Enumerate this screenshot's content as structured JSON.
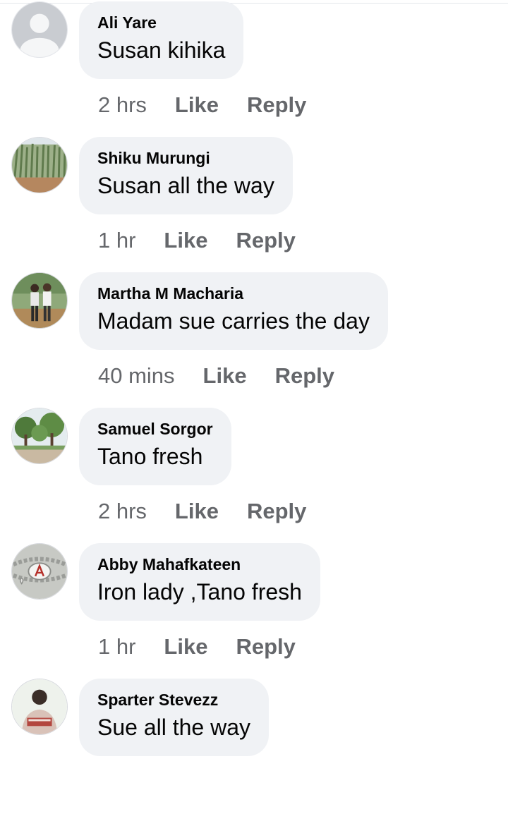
{
  "comments": [
    {
      "author": "Ali Yare",
      "text": "Susan kihika",
      "time": "2 hrs",
      "like": "Like",
      "reply": "Reply",
      "avatar_icon": "default-profile-icon"
    },
    {
      "author": "Shiku Murungi",
      "text": "Susan all the way",
      "time": "1 hr",
      "like": "Like",
      "reply": "Reply",
      "avatar_icon": "profile-photo-crops"
    },
    {
      "author": "Martha M Macharia",
      "text": "Madam sue carries the day",
      "time": "40 mins",
      "like": "Like",
      "reply": "Reply",
      "avatar_icon": "profile-photo-two-people"
    },
    {
      "author": "Samuel Sorgor",
      "text": "Tano fresh",
      "time": "2 hrs",
      "like": "Like",
      "reply": "Reply",
      "avatar_icon": "profile-photo-garden"
    },
    {
      "author": "Abby Mahafkateen",
      "text": "Iron lady ,Tano fresh",
      "time": "1 hr",
      "like": "Like",
      "reply": "Reply",
      "avatar_icon": "profile-photo-bracelet"
    },
    {
      "author": "Sparter Stevezz",
      "text": "Sue all the way",
      "time": "",
      "like": "",
      "reply": "",
      "avatar_icon": "profile-photo-person"
    }
  ],
  "colors": {
    "bubble_bg": "#f0f2f5",
    "name_text": "#050505",
    "meta_text": "#65676b"
  }
}
